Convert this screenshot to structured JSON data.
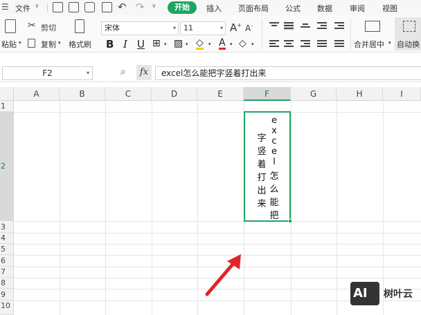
{
  "menubar": {
    "file_label": "文件",
    "tabs": [
      "开始",
      "插入",
      "页面布局",
      "公式",
      "数据",
      "审阅",
      "视图"
    ]
  },
  "ribbon": {
    "cut": "剪切",
    "paste": "粘贴",
    "copy": "复制",
    "format_painter": "格式刷",
    "font_name": "宋体",
    "font_size": "11",
    "merge_center": "合并居中",
    "auto_wrap": "自动换"
  },
  "formula_bar": {
    "cell_ref": "F2",
    "fx": "fx",
    "content": "excel怎么能把字竖着打出来"
  },
  "grid": {
    "columns": [
      "A",
      "B",
      "C",
      "D",
      "E",
      "F",
      "G",
      "H",
      "I"
    ],
    "rows": [
      "1",
      "2",
      "3",
      "4",
      "5",
      "6",
      "7",
      "8",
      "9",
      "10"
    ],
    "selected_column": "F",
    "selected_row": "2",
    "cell_f2_col1": [
      "e",
      "x",
      "c",
      "e",
      "l",
      "怎",
      "么",
      "能",
      "把"
    ],
    "cell_f2_col2": [
      "字",
      "竖",
      "着",
      "打",
      "出",
      "来"
    ]
  },
  "annotation": {
    "arrow_color": "#e0262a"
  },
  "watermark": {
    "logo": "AI",
    "text": "树叶云"
  }
}
